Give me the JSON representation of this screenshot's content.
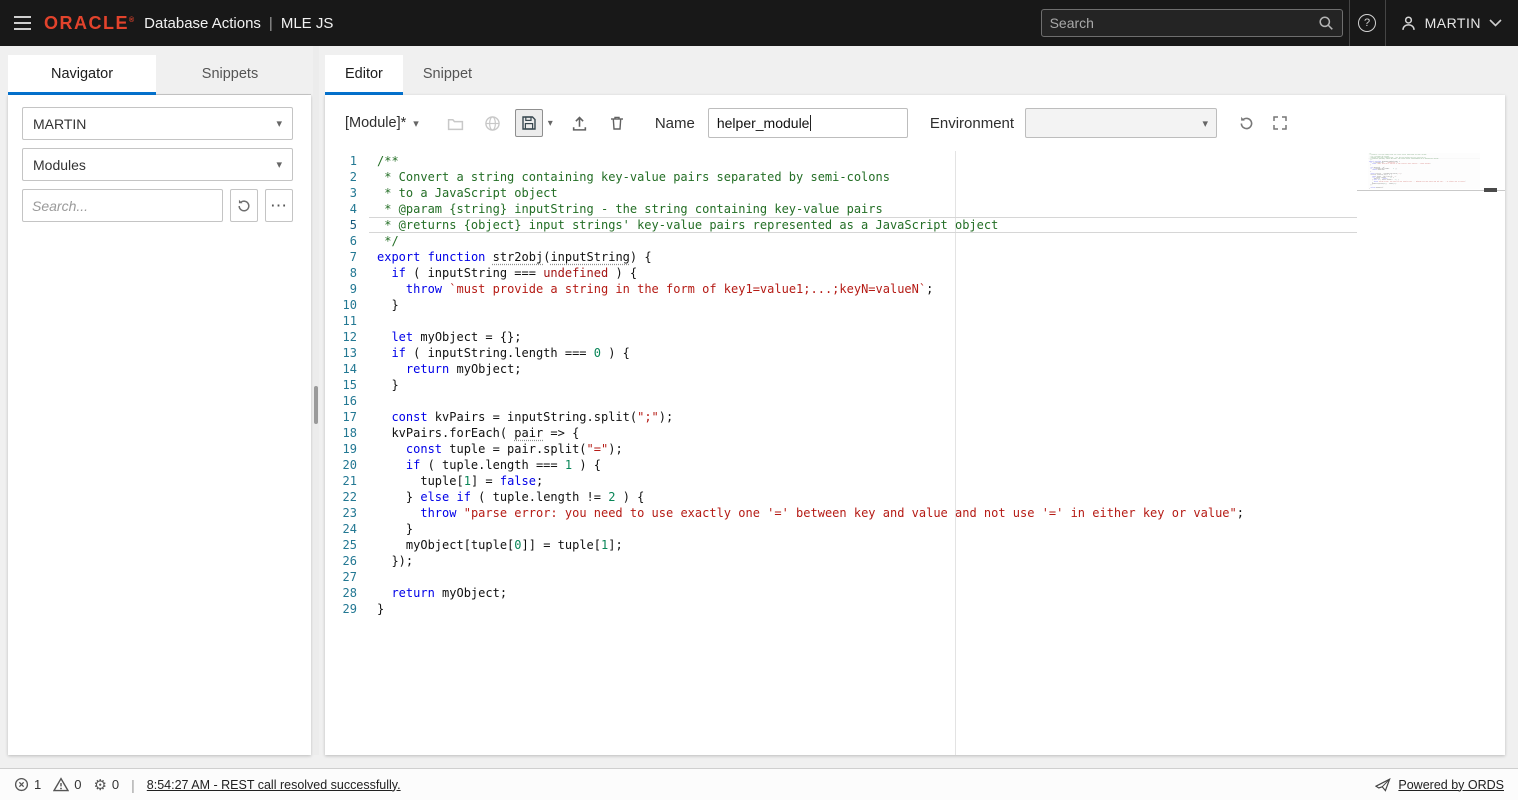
{
  "icons": {
    "caret": "▾",
    "dots": "⋯",
    "help": "?",
    "gear": "⚙"
  },
  "header": {
    "brand": "ORACLE",
    "brand_mark": "®",
    "product": "Database Actions",
    "separator": "|",
    "module": "MLE JS",
    "search_placeholder": "Search",
    "user_name": "MARTIN"
  },
  "navigator": {
    "tabs": [
      {
        "label": "Navigator"
      },
      {
        "label": "Snippets"
      }
    ],
    "schema_value": "MARTIN",
    "object_type_value": "Modules",
    "search_placeholder": "Search..."
  },
  "workspace": {
    "tabs": [
      {
        "label": "Editor"
      },
      {
        "label": "Snippet"
      }
    ],
    "toolbar": {
      "module_selector": "[Module]*",
      "name_label": "Name",
      "name_value": "helper_module",
      "environment_label": "Environment",
      "environment_value": ""
    }
  },
  "editor": {
    "active_line": 5,
    "lines": [
      [
        [
          "c",
          "/**"
        ]
      ],
      [
        [
          "c",
          " * Convert a string containing key-value pairs separated by semi-colons"
        ]
      ],
      [
        [
          "c",
          " * to a JavaScript object"
        ]
      ],
      [
        [
          "c",
          " * @param {string} inputString - the string containing key-value pairs"
        ]
      ],
      [
        [
          "c",
          " * @returns {object} input strings' key-value pairs represented as a JavaScript object"
        ]
      ],
      [
        [
          "c",
          " */"
        ]
      ],
      [
        [
          "k",
          "export"
        ],
        [
          "p",
          " "
        ],
        [
          "k",
          "function"
        ],
        [
          "p",
          " "
        ],
        [
          "m",
          "str2obj"
        ],
        [
          "p",
          "("
        ],
        [
          "m",
          "inputString"
        ],
        [
          "p",
          ") {"
        ]
      ],
      [
        [
          "p",
          "  "
        ],
        [
          "k",
          "if"
        ],
        [
          "p",
          " ( inputString === "
        ],
        [
          "u",
          "undefined"
        ],
        [
          "p",
          " ) {"
        ]
      ],
      [
        [
          "p",
          "    "
        ],
        [
          "k",
          "throw"
        ],
        [
          "p",
          " "
        ],
        [
          "s",
          "`must provide a string in the form of key1=value1;...;keyN=valueN`"
        ],
        [
          "p",
          ";"
        ]
      ],
      [
        [
          "p",
          "  }"
        ]
      ],
      [],
      [
        [
          "p",
          "  "
        ],
        [
          "k",
          "let"
        ],
        [
          "p",
          " myObject = {};"
        ]
      ],
      [
        [
          "p",
          "  "
        ],
        [
          "k",
          "if"
        ],
        [
          "p",
          " ( inputString.length === "
        ],
        [
          "n",
          "0"
        ],
        [
          "p",
          " ) {"
        ]
      ],
      [
        [
          "p",
          "    "
        ],
        [
          "k",
          "return"
        ],
        [
          "p",
          " myObject;"
        ]
      ],
      [
        [
          "p",
          "  }"
        ]
      ],
      [],
      [
        [
          "p",
          "  "
        ],
        [
          "k",
          "const"
        ],
        [
          "p",
          " kvPairs = inputString.split("
        ],
        [
          "s",
          "\";\""
        ],
        [
          "p",
          ");"
        ]
      ],
      [
        [
          "p",
          "  kvPairs.forEach( "
        ],
        [
          "m",
          "pair"
        ],
        [
          "p",
          " => {"
        ]
      ],
      [
        [
          "p",
          "    "
        ],
        [
          "k",
          "const"
        ],
        [
          "p",
          " tuple = pair.split("
        ],
        [
          "s",
          "\"=\""
        ],
        [
          "p",
          ");"
        ]
      ],
      [
        [
          "p",
          "    "
        ],
        [
          "k",
          "if"
        ],
        [
          "p",
          " ( tuple.length === "
        ],
        [
          "n",
          "1"
        ],
        [
          "p",
          " ) {"
        ]
      ],
      [
        [
          "p",
          "      tuple["
        ],
        [
          "n",
          "1"
        ],
        [
          "p",
          "] = "
        ],
        [
          "k",
          "false"
        ],
        [
          "p",
          ";"
        ]
      ],
      [
        [
          "p",
          "    } "
        ],
        [
          "k",
          "else"
        ],
        [
          "p",
          " "
        ],
        [
          "k",
          "if"
        ],
        [
          "p",
          " ( tuple.length != "
        ],
        [
          "n",
          "2"
        ],
        [
          "p",
          " ) {"
        ]
      ],
      [
        [
          "p",
          "      "
        ],
        [
          "k",
          "throw"
        ],
        [
          "p",
          " "
        ],
        [
          "s",
          "\"parse error: you need to use exactly one '=' between key and value and not use '=' in either key or value\""
        ],
        [
          "p",
          ";"
        ]
      ],
      [
        [
          "p",
          "    }"
        ]
      ],
      [
        [
          "p",
          "    myObject[tuple["
        ],
        [
          "n",
          "0"
        ],
        [
          "p",
          "]] = tuple["
        ],
        [
          "n",
          "1"
        ],
        [
          "p",
          "];"
        ]
      ],
      [
        [
          "p",
          "  });"
        ]
      ],
      [],
      [
        [
          "p",
          "  "
        ],
        [
          "k",
          "return"
        ],
        [
          "p",
          " myObject;"
        ]
      ],
      [
        [
          "p",
          "}"
        ]
      ]
    ]
  },
  "status_bar": {
    "error_count": "1",
    "warning_count": "0",
    "process_count": "0",
    "divider": "|",
    "message": "8:54:27 AM - REST call resolved successfully.",
    "powered_by": "Powered by ORDS"
  }
}
